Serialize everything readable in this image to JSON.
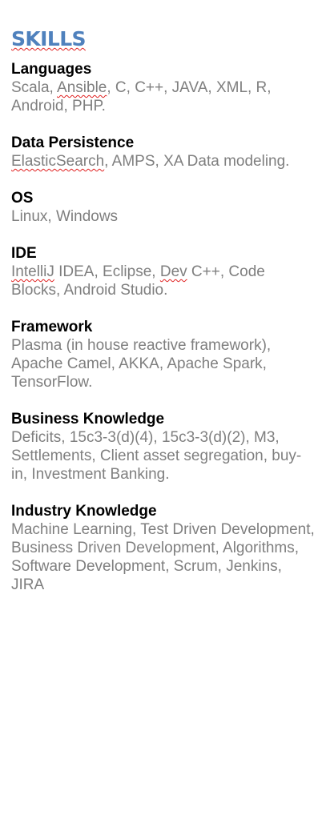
{
  "heading": "SKILLS",
  "sections": [
    {
      "title": "Languages",
      "body": [
        {
          "text": "Scala, "
        },
        {
          "text": "Ansible",
          "misspelled": true
        },
        {
          "text": ", C, C++, JAVA, XML, R, Android, PHP."
        }
      ]
    },
    {
      "title": "Data Persistence",
      "body": [
        {
          "text": "ElasticSearch",
          "misspelled": true
        },
        {
          "text": ", AMPS, XA Data modeling."
        }
      ]
    },
    {
      "title": "OS",
      "body": [
        {
          "text": "Linux, Windows"
        }
      ]
    },
    {
      "title": "IDE",
      "body": [
        {
          "text": "IntelliJ",
          "misspelled": true
        },
        {
          "text": " IDEA, Eclipse, "
        },
        {
          "text": "Dev",
          "misspelled": true
        },
        {
          "text": " C++, Code Blocks, Android Studio."
        }
      ]
    },
    {
      "title": "Framework",
      "body": [
        {
          "text": "Plasma (in house reactive framework), Apache Camel, AKKA, Apache Spark, TensorFlow."
        }
      ]
    },
    {
      "title": "Business Knowledge",
      "body": [
        {
          "text": "Deficits, 15c3-3(d)(4), 15c3-3(d)(2), M3, Settlements, Client asset segregation, buy-in, Investment Banking."
        }
      ]
    },
    {
      "title": "Industry Knowledge",
      "body": [
        {
          "text": "Machine Learning, Test Driven Development, Business Driven Development, Algorithms, Software Development, Scrum, Jenkins, JIRA"
        }
      ]
    }
  ]
}
